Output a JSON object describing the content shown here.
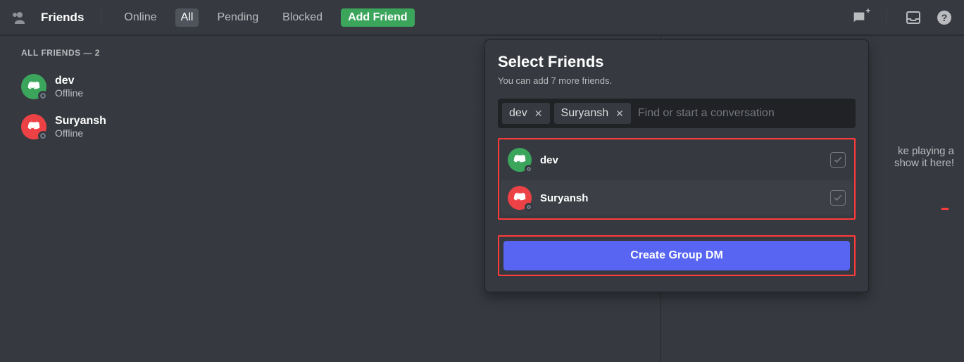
{
  "header": {
    "title": "Friends",
    "tabs": {
      "online": "Online",
      "all": "All",
      "pending": "Pending",
      "blocked": "Blocked",
      "add": "Add Friend"
    }
  },
  "list": {
    "heading": "ALL FRIENDS — 2",
    "items": [
      {
        "name": "dev",
        "status": "Offline",
        "avatar_color": "green"
      },
      {
        "name": "Suryansh",
        "status": "Offline",
        "avatar_color": "red"
      }
    ]
  },
  "nowplaying": {
    "line1": "ke playing a",
    "line2": "show it here!"
  },
  "popover": {
    "title": "Select Friends",
    "subtitle": "You can add 7 more friends.",
    "chips": [
      {
        "label": "dev"
      },
      {
        "label": "Suryansh"
      }
    ],
    "search_placeholder": "Find or start a conversation",
    "results": [
      {
        "name": "dev",
        "avatar_color": "green",
        "checked": true
      },
      {
        "name": "Suryansh",
        "avatar_color": "red",
        "checked": true
      }
    ],
    "create_label": "Create Group DM"
  }
}
